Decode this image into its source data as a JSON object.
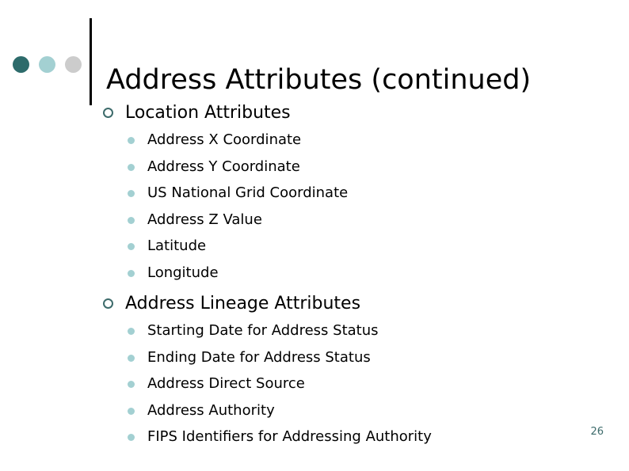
{
  "slide": {
    "title": "Address Attributes (continued)",
    "page_number": "26",
    "decor": {
      "dot_1_color": "#2d6b6b",
      "dot_2_color": "#a3d0d2",
      "dot_3_color": "#cccccc",
      "rule_color": "#000000",
      "accent_color": "#3d6b6b",
      "sub_bullet_color": "#a3d0d2"
    },
    "sections": [
      {
        "heading": "Location Attributes",
        "items": [
          "Address X Coordinate",
          "Address Y Coordinate",
          "US National Grid Coordinate",
          "Address Z Value",
          "Latitude",
          "Longitude"
        ]
      },
      {
        "heading": "Address Lineage Attributes",
        "items": [
          "Starting Date for Address Status",
          "Ending Date for Address Status",
          "Address Direct Source",
          "Address Authority",
          "FIPS Identifiers for Addressing Authority"
        ]
      }
    ]
  }
}
